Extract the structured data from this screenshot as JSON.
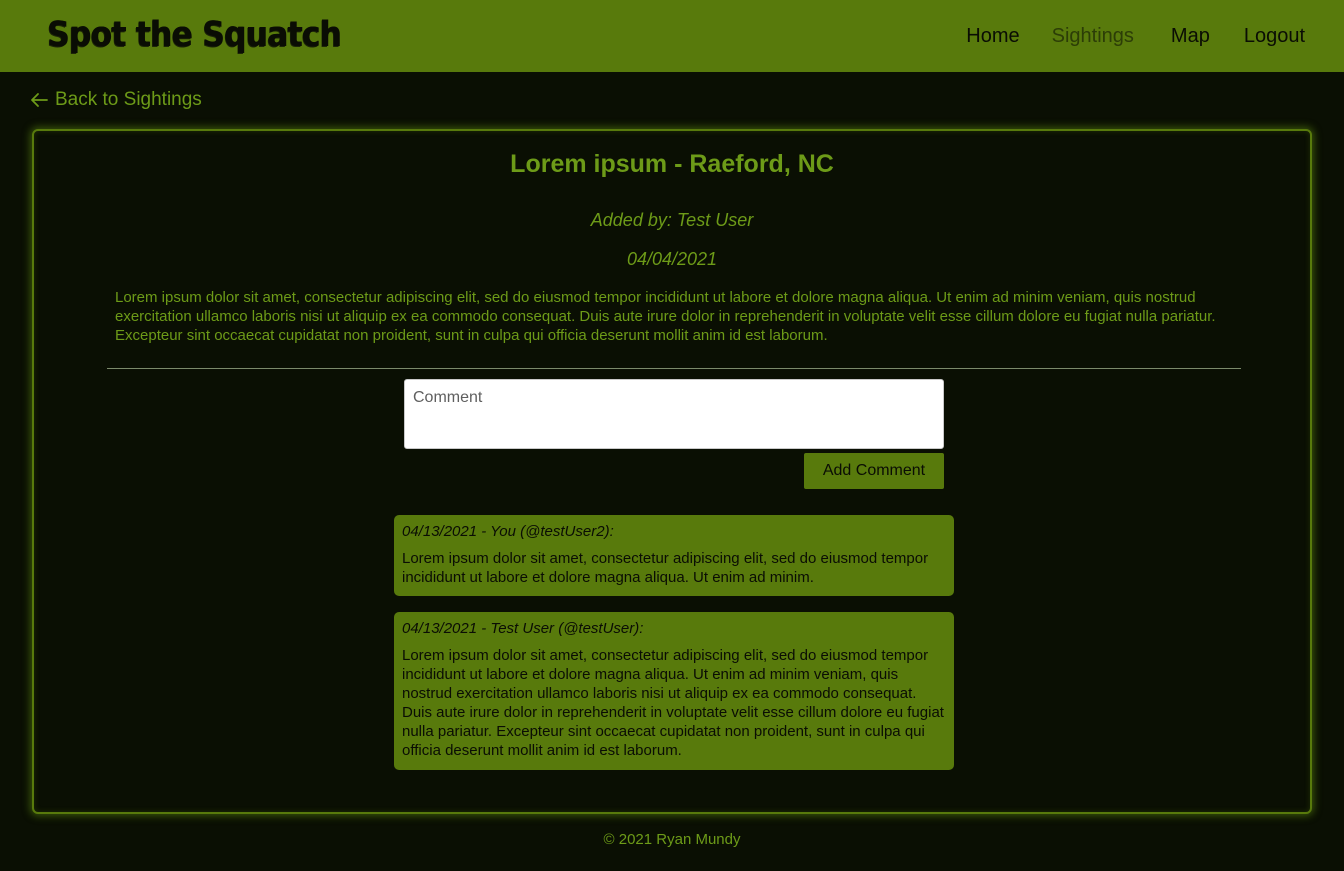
{
  "navbar": {
    "brand": "Spot the Squatch",
    "links": [
      {
        "label": "Home",
        "active": false
      },
      {
        "label": "Sightings",
        "active": true
      },
      {
        "label": "Map",
        "active": false
      },
      {
        "label": "Logout",
        "active": false
      }
    ]
  },
  "back_link": {
    "icon": "arrow-left-icon",
    "label": "Back to Sightings"
  },
  "sighting": {
    "title": "Lorem ipsum - Raeford, NC",
    "added_by": "Added by: Test User",
    "date": "04/04/2021",
    "description": "Lorem ipsum dolor sit amet, consectetur adipiscing elit, sed do eiusmod tempor incididunt ut labore et dolore magna aliqua. Ut enim ad minim veniam, quis nostrud exercitation ullamco laboris nisi ut aliquip ex ea commodo consequat. Duis aute irure dolor in reprehenderit in voluptate velit esse cillum dolore eu fugiat nulla pariatur. Excepteur sint occaecat cupidatat non proident, sunt in culpa qui officia deserunt mollit anim id est laborum."
  },
  "comment_form": {
    "placeholder": "Comment",
    "value": "",
    "submit_label": "Add Comment"
  },
  "comments": [
    {
      "meta": "04/13/2021 - You (@testUser2):",
      "body": "Lorem ipsum dolor sit amet, consectetur adipiscing elit, sed do eiusmod tempor incididunt ut labore et dolore magna aliqua. Ut enim ad minim."
    },
    {
      "meta": "04/13/2021 - Test User (@testUser):",
      "body": "Lorem ipsum dolor sit amet, consectetur adipiscing elit, sed do eiusmod tempor incididunt ut labore et dolore magna aliqua. Ut enim ad minim veniam, quis nostrud exercitation ullamco laboris nisi ut aliquip ex ea commodo consequat. Duis aute irure dolor in reprehenderit in voluptate velit esse cillum dolore eu fugiat nulla pariatur. Excepteur sint occaecat cupidatat non proident, sunt in culpa qui officia deserunt mollit anim id est laborum."
    }
  ],
  "footer": {
    "text": "© 2021 Ryan Mundy"
  },
  "colors": {
    "brand_green": "#587a0c",
    "text_green": "#6d9b18",
    "background": "#0a0f03",
    "dark_text": "#0a0d04"
  }
}
